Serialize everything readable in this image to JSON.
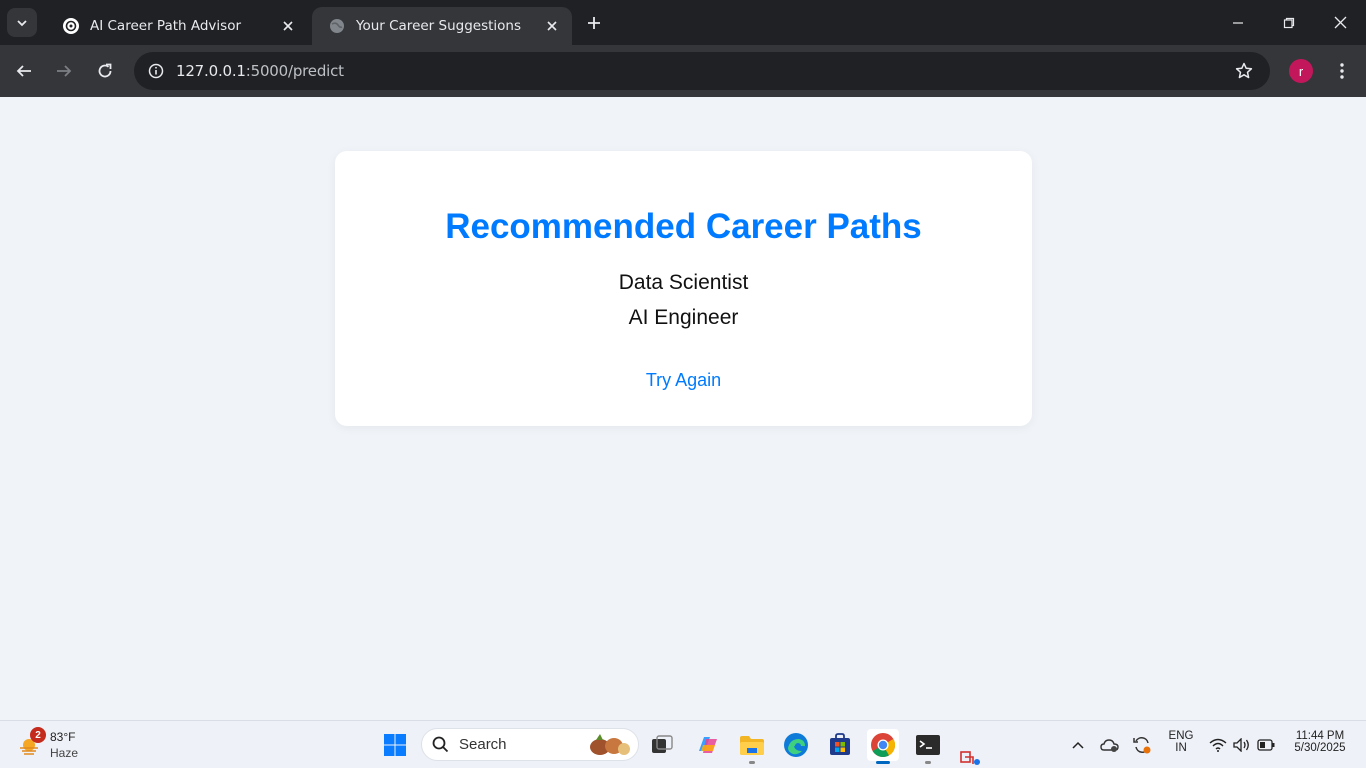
{
  "browser": {
    "tabs": [
      {
        "title": "AI Career Path Advisor",
        "active": false
      },
      {
        "title": "Your Career Suggestions",
        "active": true
      }
    ],
    "address": {
      "host": "127.0.0.1",
      "rest": ":5000/predict"
    },
    "profile_initial": "r"
  },
  "page": {
    "heading": "Recommended Career Paths",
    "careers": [
      "Data Scientist",
      "AI Engineer"
    ],
    "try_again": "Try Again",
    "accent_color": "#007bff"
  },
  "taskbar": {
    "weather": {
      "temp": "83°F",
      "condition": "Haze",
      "badge": "2"
    },
    "search_label": "Search",
    "language": {
      "line1": "ENG",
      "line2": "IN"
    },
    "clock": {
      "time": "11:44 PM",
      "date": "5/30/2025"
    }
  }
}
